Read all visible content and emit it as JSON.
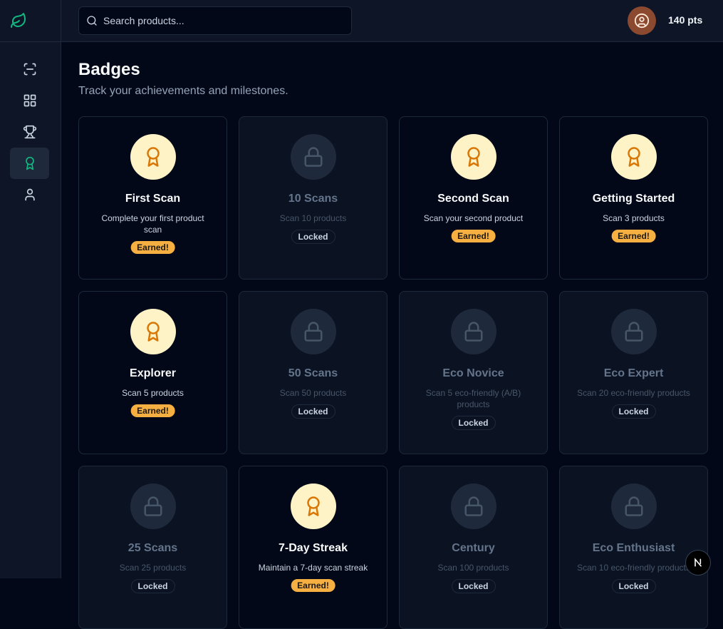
{
  "search": {
    "placeholder": "Search products..."
  },
  "user": {
    "points": "140 pts"
  },
  "page": {
    "title": "Badges",
    "subtitle": "Track your achievements and milestones."
  },
  "status_labels": {
    "earned": "Earned!",
    "locked": "Locked"
  },
  "colors": {
    "accent": "#10b981",
    "earned_pill": "#f5b041",
    "badge_bg": "#fef3c7",
    "badge_icon": "#d97706"
  },
  "nav": [
    {
      "name": "scan",
      "icon": "scan-icon"
    },
    {
      "name": "dashboard",
      "icon": "dashboard-icon"
    },
    {
      "name": "leaderboard",
      "icon": "trophy-icon"
    },
    {
      "name": "badges",
      "icon": "award-icon",
      "active": true
    },
    {
      "name": "profile",
      "icon": "user-icon"
    }
  ],
  "badges": [
    {
      "title": "First Scan",
      "description": "Complete your first product scan",
      "earned": true
    },
    {
      "title": "10 Scans",
      "description": "Scan 10 products",
      "earned": false
    },
    {
      "title": "Second Scan",
      "description": "Scan your second product",
      "earned": true
    },
    {
      "title": "Getting Started",
      "description": "Scan 3 products",
      "earned": true
    },
    {
      "title": "Explorer",
      "description": "Scan 5 products",
      "earned": true
    },
    {
      "title": "50 Scans",
      "description": "Scan 50 products",
      "earned": false
    },
    {
      "title": "Eco Novice",
      "description": "Scan 5 eco-friendly (A/B) products",
      "earned": false
    },
    {
      "title": "Eco Expert",
      "description": "Scan 20 eco-friendly products",
      "earned": false
    },
    {
      "title": "25 Scans",
      "description": "Scan 25 products",
      "earned": false
    },
    {
      "title": "7-Day Streak",
      "description": "Maintain a 7-day scan streak",
      "earned": true
    },
    {
      "title": "Century",
      "description": "Scan 100 products",
      "earned": false
    },
    {
      "title": "Eco Enthusiast",
      "description": "Scan 10 eco-friendly products",
      "earned": false
    }
  ]
}
